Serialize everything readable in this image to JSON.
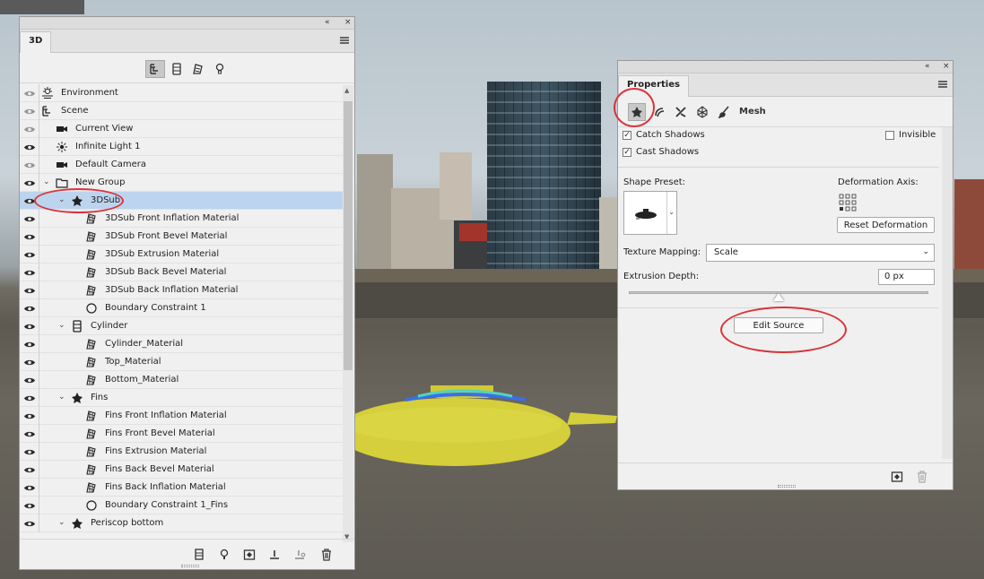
{
  "panel3d": {
    "tab": "3D",
    "collapse_icon": "«",
    "close_icon": "×",
    "filters": [
      "whole-scene-filter",
      "meshes-filter",
      "materials-filter",
      "lights-filter"
    ],
    "tree": [
      {
        "label": "Environment",
        "icon": "environment-icon",
        "level": 0,
        "eye_dim": true
      },
      {
        "label": "Scene",
        "icon": "scene-icon",
        "level": 0,
        "eye_dim": true
      },
      {
        "label": "Current View",
        "icon": "camera-icon",
        "level": 1,
        "eye_dim": true
      },
      {
        "label": "Infinite Light 1",
        "icon": "light-icon",
        "level": 1,
        "eye_dim": false
      },
      {
        "label": "Default Camera",
        "icon": "camera-icon",
        "level": 1,
        "eye_dim": true
      },
      {
        "label": "New Group",
        "icon": "folder-icon",
        "level": 1,
        "expanded": true,
        "eye_dim": false
      },
      {
        "label": "3DSub",
        "icon": "mesh-icon",
        "level": 2,
        "expanded": true,
        "selected": true,
        "eye_dim": false
      },
      {
        "label": "3DSub Front Inflation Material",
        "icon": "material-icon",
        "level": 3,
        "eye_dim": false
      },
      {
        "label": "3DSub Front Bevel Material",
        "icon": "material-icon",
        "level": 3,
        "eye_dim": false
      },
      {
        "label": "3DSub Extrusion Material",
        "icon": "material-icon",
        "level": 3,
        "eye_dim": false
      },
      {
        "label": "3DSub Back Bevel Material",
        "icon": "material-icon",
        "level": 3,
        "eye_dim": false
      },
      {
        "label": "3DSub Back Inflation Material",
        "icon": "material-icon",
        "level": 3,
        "eye_dim": false
      },
      {
        "label": "Boundary Constraint 1",
        "icon": "constraint-icon",
        "level": 3,
        "eye_dim": false
      },
      {
        "label": "Cylinder",
        "icon": "cylinder-icon",
        "level": 2,
        "expanded": true,
        "eye_dim": false
      },
      {
        "label": "Cylinder_Material",
        "icon": "material-icon",
        "level": 3,
        "eye_dim": false
      },
      {
        "label": "Top_Material",
        "icon": "material-icon",
        "level": 3,
        "eye_dim": false
      },
      {
        "label": "Bottom_Material",
        "icon": "material-icon",
        "level": 3,
        "eye_dim": false
      },
      {
        "label": "Fins",
        "icon": "mesh-icon",
        "level": 2,
        "expanded": true,
        "eye_dim": false
      },
      {
        "label": "Fins Front Inflation Material",
        "icon": "material-icon",
        "level": 3,
        "eye_dim": false
      },
      {
        "label": "Fins Front Bevel Material",
        "icon": "material-icon",
        "level": 3,
        "eye_dim": false
      },
      {
        "label": "Fins Extrusion Material",
        "icon": "material-icon",
        "level": 3,
        "eye_dim": false
      },
      {
        "label": "Fins Back Bevel Material",
        "icon": "material-icon",
        "level": 3,
        "eye_dim": false
      },
      {
        "label": "Fins Back Inflation Material",
        "icon": "material-icon",
        "level": 3,
        "eye_dim": false
      },
      {
        "label": "Boundary Constraint 1_Fins",
        "icon": "constraint-icon",
        "level": 3,
        "eye_dim": false
      },
      {
        "label": "Periscop bottom",
        "icon": "mesh-icon",
        "level": 2,
        "expanded": true,
        "eye_dim": false
      }
    ],
    "bottom_buttons": [
      "add-mesh-button",
      "add-light-button",
      "render-button",
      "ground-button",
      "drop-to-plane-button",
      "delete-button"
    ]
  },
  "properties": {
    "tab": "Properties",
    "collapse_icon": "«",
    "close_icon": "×",
    "mode_buttons": [
      "mesh-mode-button",
      "deform-mode-button",
      "cap-mode-button",
      "coordinates-mode-button",
      "paint-mode-button"
    ],
    "mode_label": "Mesh",
    "catch_shadows": {
      "label": "Catch Shadows",
      "checked": true
    },
    "invisible": {
      "label": "Invisible",
      "checked": false
    },
    "cast_shadows": {
      "label": "Cast Shadows",
      "checked": true
    },
    "shape_preset_label": "Shape Preset:",
    "deformation_axis_label": "Deformation Axis:",
    "reset_deformation": "Reset Deformation",
    "texture_mapping_label": "Texture Mapping:",
    "texture_mapping_value": "Scale",
    "extrusion_depth_label": "Extrusion Depth:",
    "extrusion_depth_value": "0 px",
    "edit_source": "Edit Source"
  },
  "colors": {
    "panel_bg": "#f0f0f0",
    "selection": "#bcd4ee",
    "annotation": "#d9343a",
    "submarine": "#d4cf3a"
  }
}
